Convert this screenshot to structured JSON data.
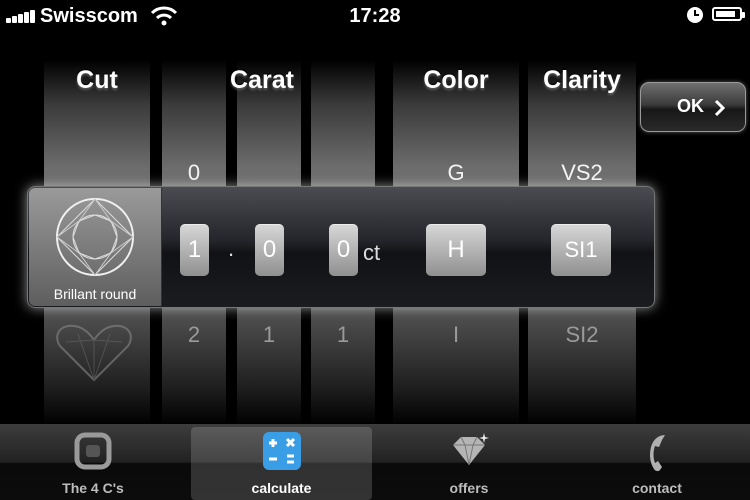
{
  "status_bar": {
    "carrier": "Swisscom",
    "time": "17:28",
    "battery_level": 0.85
  },
  "picker": {
    "headers": {
      "cut": "Cut",
      "carat": "Carat",
      "color": "Color",
      "clarity": "Clarity"
    },
    "cut": {
      "selected_label": "Brillant round",
      "selected_icon": "round-diamond-icon",
      "next_icon": "heart-diamond-icon"
    },
    "carat": {
      "digit1": {
        "above": "0",
        "selected": "1",
        "below": "2"
      },
      "digit2": {
        "above": "",
        "selected": "0",
        "below": "1"
      },
      "digit3": {
        "above": "",
        "selected": "0",
        "below": "1"
      },
      "separator": ".",
      "unit": "ct"
    },
    "color": {
      "above": "G",
      "selected": "H",
      "below": "I"
    },
    "clarity": {
      "above": "VS2",
      "selected": "SI1",
      "below": "SI2"
    }
  },
  "ok_button": {
    "label": "OK"
  },
  "tabs": [
    {
      "label": "The 4 C's",
      "icon": "ring-icon",
      "active": false
    },
    {
      "label": "calculate",
      "icon": "calculator-icon",
      "active": true
    },
    {
      "label": "offers",
      "icon": "diamond-icon",
      "active": false
    },
    {
      "label": "contact",
      "icon": "phone-icon",
      "active": false
    }
  ]
}
